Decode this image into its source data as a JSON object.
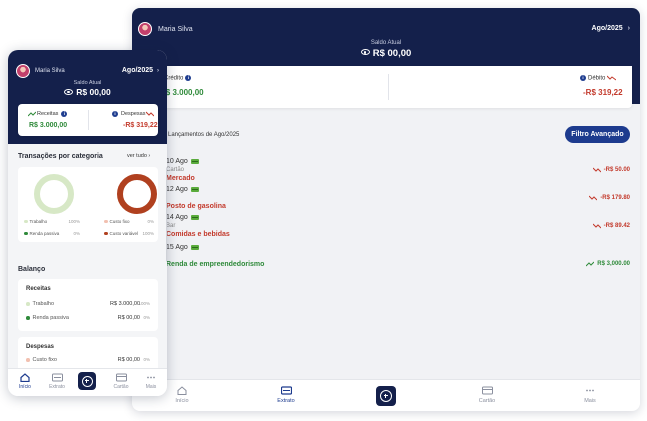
{
  "colors": {
    "navy": "#14204b",
    "accent": "#1d3b8e",
    "positive": "#2f8a3a",
    "negative": "#c33a2c",
    "income_light": "#d7e8c6",
    "expense_dark": "#b0401f"
  },
  "user": {
    "name": "Maria Silva"
  },
  "period": {
    "month": "Ago/2025"
  },
  "balance": {
    "label": "Saldo Atual",
    "value": "R$ 00,00"
  },
  "tablet": {
    "credit": {
      "label": "Crédito",
      "value": "R$ 3.000,00"
    },
    "debit": {
      "label": "Débito",
      "value": "-R$ 319,22"
    },
    "list_title": "Lançamentos de Ago/2025",
    "filter_button": "Filtro Avançado",
    "transactions": [
      {
        "day": "10 Ago",
        "sub": "Cartão",
        "desc": "Mercado",
        "amount": "-R$ 50.00",
        "type": "neg"
      },
      {
        "day": "12 Ago",
        "sub": "",
        "desc": "Posto de gasolina",
        "amount": "-R$ 179.80",
        "type": "neg"
      },
      {
        "day": "14 Ago",
        "sub": "Bar",
        "desc": "Comidas e bebidas",
        "amount": "-R$ 89.42",
        "type": "neg"
      },
      {
        "day": "15 Ago",
        "sub": "",
        "desc": "Renda de empreendedorismo",
        "amount": "R$ 3,000.00",
        "type": "pos"
      }
    ],
    "nav": [
      "Início",
      "Extrato",
      "Cartão",
      "Mais"
    ]
  },
  "phone": {
    "income": {
      "label": "Receitas",
      "value": "R$ 3.000,00"
    },
    "expense": {
      "label": "Despesas",
      "value": "-R$ 319,22"
    },
    "category_title": "Transações por categoria",
    "see_all": "ver tudo",
    "income_legend": [
      {
        "label": "Trabalho",
        "pct": "100%"
      },
      {
        "label": "Renda passiva",
        "pct": "0%"
      }
    ],
    "expense_legend": [
      {
        "label": "Custo fixo",
        "pct": "0%"
      },
      {
        "label": "Custo variável",
        "pct": "100%"
      }
    ],
    "balance_title": "Balanço",
    "income_card": {
      "title": "Receitas",
      "rows": [
        {
          "label": "Trabalho",
          "value": "R$ 3.000,00",
          "pct": "100%"
        },
        {
          "label": "Renda passiva",
          "value": "R$ 00,00",
          "pct": "0%"
        }
      ]
    },
    "expense_card": {
      "title": "Despesas",
      "rows": [
        {
          "label": "Custo fixo",
          "value": "R$ 00,00",
          "pct": "0%"
        }
      ]
    },
    "nav": [
      "Início",
      "Extrato",
      "Cartão",
      "Mais"
    ]
  }
}
